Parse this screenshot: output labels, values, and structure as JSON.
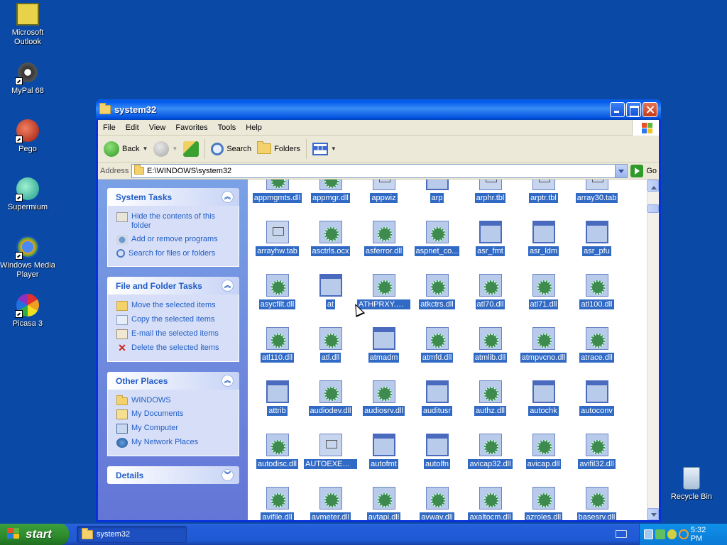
{
  "desktop": {
    "icons": [
      {
        "label": "Microsoft Outlook",
        "icon": "outlook-icon"
      },
      {
        "label": "MyPal 68",
        "icon": "mypal-icon"
      },
      {
        "label": "Pego",
        "icon": "pego-icon"
      },
      {
        "label": "Supermium",
        "icon": "supermium-icon"
      },
      {
        "label": "Windows Media Player",
        "icon": "media-player-icon"
      },
      {
        "label": "Picasa 3",
        "icon": "picasa-icon"
      },
      {
        "label": "Recycle Bin",
        "icon": "recycle-bin-icon"
      }
    ]
  },
  "window": {
    "title": "system32",
    "menu": [
      "File",
      "Edit",
      "View",
      "Favorites",
      "Tools",
      "Help"
    ],
    "toolbar": {
      "back": "Back",
      "search": "Search",
      "folders": "Folders"
    },
    "address": {
      "label": "Address",
      "value": "E:\\WINDOWS\\system32",
      "go": "Go"
    }
  },
  "sidebar": {
    "system_tasks": {
      "title": "System Tasks",
      "items": [
        "Hide the contents of this folder",
        "Add or remove programs",
        "Search for files or folders"
      ]
    },
    "file_tasks": {
      "title": "File and Folder Tasks",
      "items": [
        "Move the selected items",
        "Copy the selected items",
        "E-mail the selected items",
        "Delete the selected items"
      ]
    },
    "other_places": {
      "title": "Other Places",
      "items": [
        "WINDOWS",
        "My Documents",
        "My Computer",
        "My Network Places"
      ]
    },
    "details": {
      "title": "Details"
    }
  },
  "files": [
    [
      "appmgmts.dll",
      "appmgr.dll",
      "appwiz",
      "arp",
      "arphr.tbl",
      "arptr.tbl",
      "array30.tab"
    ],
    [
      "arrayhw.tab",
      "asctrls.ocx",
      "asferror.dll",
      "aspnet_co...",
      "asr_fmt",
      "asr_ldm",
      "asr_pfu"
    ],
    [
      "asycfilt.dll",
      "at",
      "ATHPRXY.DLL",
      "atkctrs.dll",
      "atl70.dll",
      "atl71.dll",
      "atl100.dll"
    ],
    [
      "atl110.dll",
      "atl.dll",
      "atmadm",
      "atmfd.dll",
      "atmlib.dll",
      "atmpvcno.dll",
      "atrace.dll"
    ],
    [
      "attrib",
      "audiodev.dll",
      "audiosrv.dll",
      "auditusr",
      "authz.dll",
      "autochk",
      "autoconv"
    ],
    [
      "autodisc.dll",
      "AUTOEXEC.NT",
      "autofmt",
      "autolfn",
      "avicap32.dll",
      "avicap.dll",
      "avifil32.dll"
    ],
    [
      "avifile.dll",
      "avmeter.dll",
      "avtapi.dll",
      "avwav.dll",
      "axaltocm.dll",
      "azroles.dll",
      "basesrv.dll"
    ]
  ],
  "file_types": [
    [
      "dll",
      "dll",
      "tbl",
      "exe",
      "tbl",
      "tbl",
      "tbl"
    ],
    [
      "tbl",
      "dll",
      "dll",
      "dll",
      "exe",
      "exe",
      "exe"
    ],
    [
      "dll",
      "exe",
      "dll",
      "dll",
      "dll",
      "dll",
      "dll"
    ],
    [
      "dll",
      "dll",
      "exe",
      "dll",
      "dll",
      "dll",
      "dll"
    ],
    [
      "exe",
      "dll",
      "dll",
      "exe",
      "dll",
      "exe",
      "exe"
    ],
    [
      "dll",
      "tbl",
      "exe",
      "exe",
      "dll",
      "dll",
      "dll"
    ],
    [
      "dll",
      "dll",
      "dll",
      "dll",
      "dll",
      "dll",
      "dll"
    ]
  ],
  "taskbar": {
    "start": "start",
    "task_button": "system32",
    "clock": "5:32 PM"
  }
}
